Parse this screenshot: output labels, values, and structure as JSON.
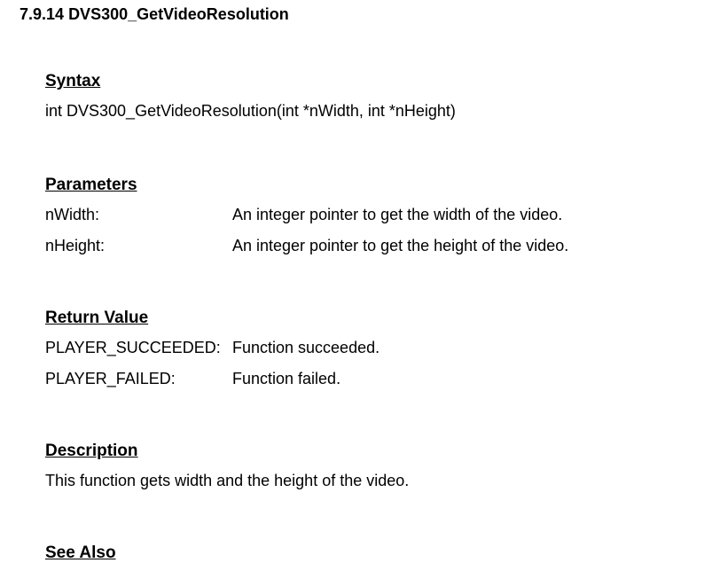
{
  "heading": {
    "number": "7.9.14",
    "title": "DVS300_GetVideoResolution"
  },
  "syntax": {
    "label": "Syntax",
    "text": "int DVS300_GetVideoResolution(int *nWidth, int *nHeight)"
  },
  "parameters": {
    "label": "Parameters",
    "items": [
      {
        "name": "nWidth:",
        "desc": "An integer pointer to get the width of the video."
      },
      {
        "name": "nHeight:",
        "desc": "An integer pointer to get the height of the video."
      }
    ]
  },
  "return_value": {
    "label": "Return Value",
    "items": [
      {
        "name": "PLAYER_SUCCEEDED:",
        "desc": "Function succeeded."
      },
      {
        "name": "PLAYER_FAILED:",
        "desc": "Function failed."
      }
    ]
  },
  "description": {
    "label": "Description",
    "text": "This function gets width and the height of the video."
  },
  "see_also": {
    "label": "See Also"
  }
}
